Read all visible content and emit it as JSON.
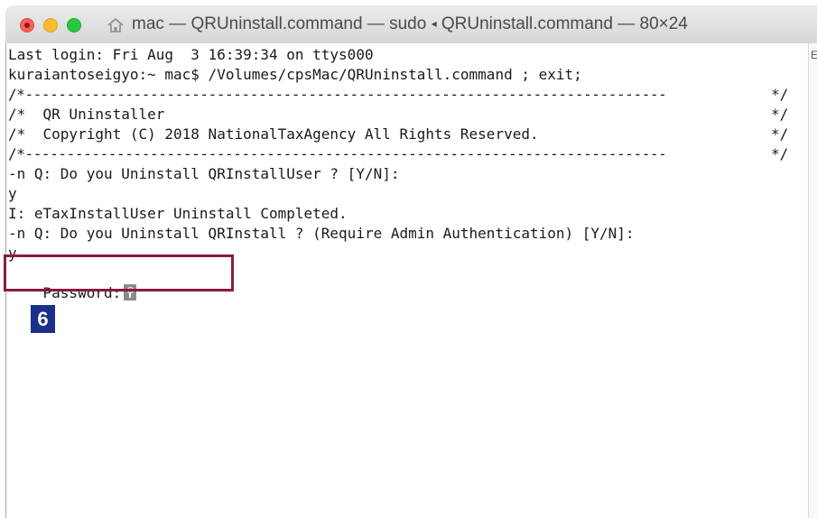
{
  "window": {
    "title_prefix": "mac — QRUninstall.command — sudo",
    "title_separator": "◂",
    "title_suffix": "QRUninstall.command — 80×24"
  },
  "terminal": {
    "lines": [
      "Last login: Fri Aug  3 16:39:34 on ttys000",
      "kuraiantoseigyo:~ mac$ /Volumes/cpsMac/QRUninstall.command ; exit;",
      "/*-----------------------------------------------------------------------------",
      "/*  QR Uninstaller",
      "/*  Copyright (C) 2018 NationalTaxAgency All Rights Reserved.",
      "/*-----------------------------------------------------------------------------",
      "-n Q: Do you Uninstall QRInstallUser ? [Y/N]:",
      "y",
      "I: eTaxInstallUser Uninstall Completed.",
      "-n Q: Do you Uninstall QRInstall ? (Require Admin Authentication) [Y/N]:",
      "y"
    ],
    "right_border_dashed": "*/",
    "right_border_plain": "*/",
    "password_prompt": "Password:"
  },
  "scrollbar": {
    "mark": "E"
  },
  "annotation": {
    "step_number": "6"
  },
  "colors": {
    "highlight_border": "#8b1a3e",
    "badge_background": "#1a2f8a"
  }
}
